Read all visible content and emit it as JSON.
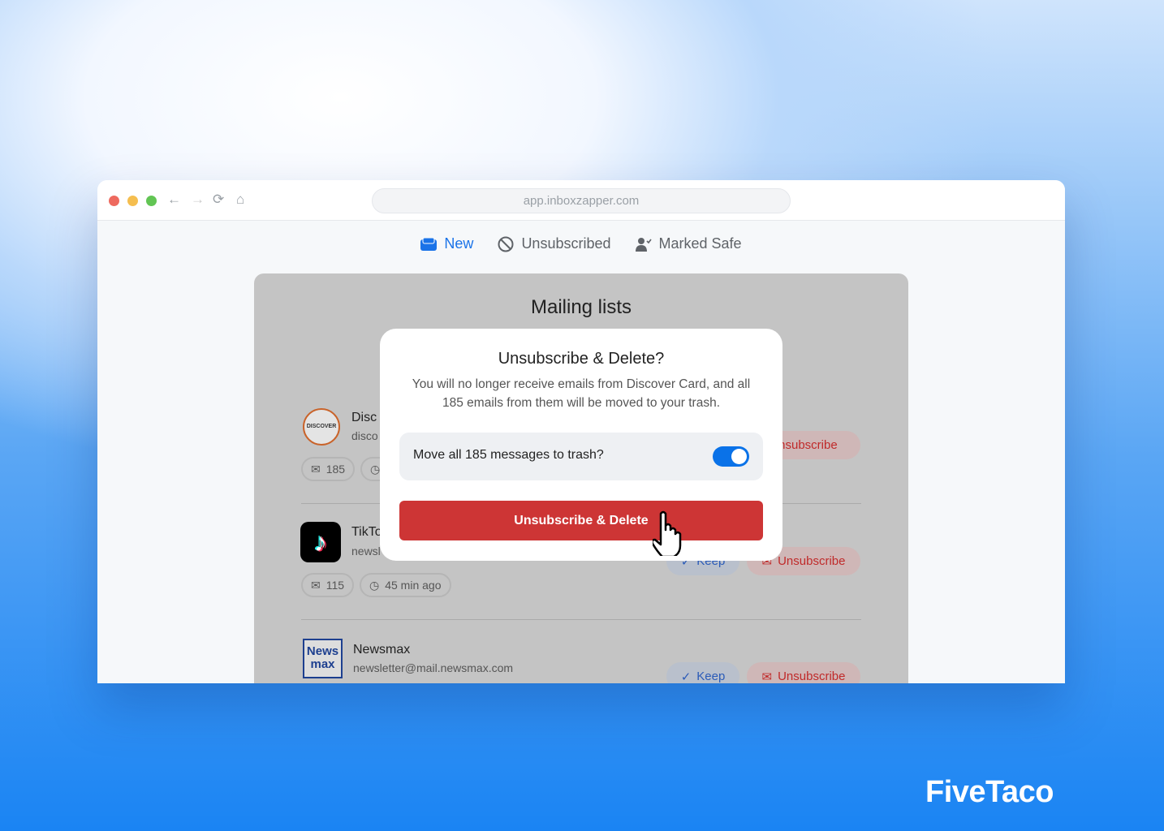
{
  "browser": {
    "url": "app.inboxzapper.com",
    "traffic_colors": [
      "#ee6a5f",
      "#f5be4f",
      "#62c554"
    ]
  },
  "tabs": [
    {
      "label": "New",
      "icon": "inbox-icon",
      "active": true
    },
    {
      "label": "Unsubscribed",
      "icon": "ban-icon"
    },
    {
      "label": "Marked Safe",
      "icon": "user-check-icon"
    }
  ],
  "panel": {
    "title": "Mailing lists"
  },
  "rows": [
    {
      "name": "Disc",
      "email": "disco",
      "logo": "DISCOVER",
      "count": "185",
      "unsubscribe": "Unsubscribe"
    },
    {
      "name": "TikTo",
      "email": "newsl",
      "count": "115",
      "time": "45 min ago",
      "keep": "Keep",
      "unsubscribe": "Unsubscribe"
    },
    {
      "name": "Newsmax",
      "email": "newsletter@mail.newsmax.com",
      "logo": "News max",
      "keep": "Keep",
      "unsubscribe": "Unsubscribe"
    }
  ],
  "modal": {
    "title": "Unsubscribe & Delete?",
    "text": "You will no longer receive emails from Discover Card, and all 185 emails from them will be moved to your trash.",
    "toggle_label": "Move all 185 messages to trash?",
    "toggle_on": true,
    "confirm": "Unsubscribe & Delete"
  },
  "brand": "FiveTaco"
}
